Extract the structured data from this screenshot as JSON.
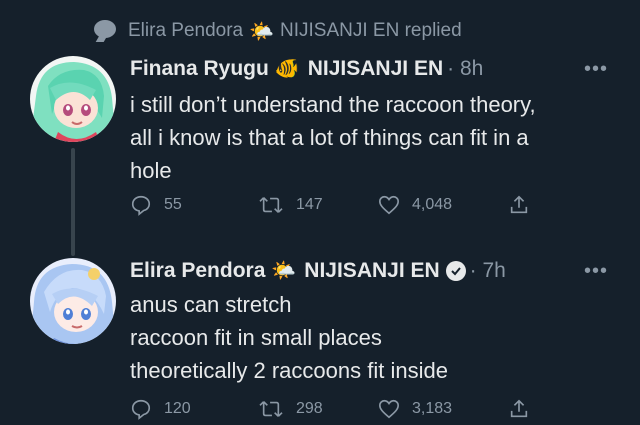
{
  "context": {
    "user": "Elira Pendora",
    "user_emoji": "🌤️",
    "affiliation_replied": "NIJISANJI EN replied",
    "icon": "comment-bubble-icon"
  },
  "tweets": [
    {
      "name": "Finana Ryugu",
      "name_emoji": "🐠",
      "handle_tag": "NIJISANJI EN",
      "time": "· 8h",
      "more": "•••",
      "body": "i still don’t understand the raccoon theory,\nall i know is that a lot of things can fit in a\nhole",
      "replies": "55",
      "retweets": "147",
      "likes": "4,048",
      "verified": false
    },
    {
      "name": "Elira Pendora",
      "name_emoji": "🌤️",
      "handle_tag": "NIJISANJI EN",
      "time": "· 7h",
      "more": "•••",
      "body": "anus can stretch\nraccoon fit in small places\ntheoretically 2 raccoons fit inside",
      "replies": "120",
      "retweets": "298",
      "likes": "3,183",
      "verified": true
    }
  ],
  "colors": {
    "background": "#15202b",
    "text": "#e7e9ea",
    "muted": "#8b98a5",
    "line": "#38444d"
  }
}
